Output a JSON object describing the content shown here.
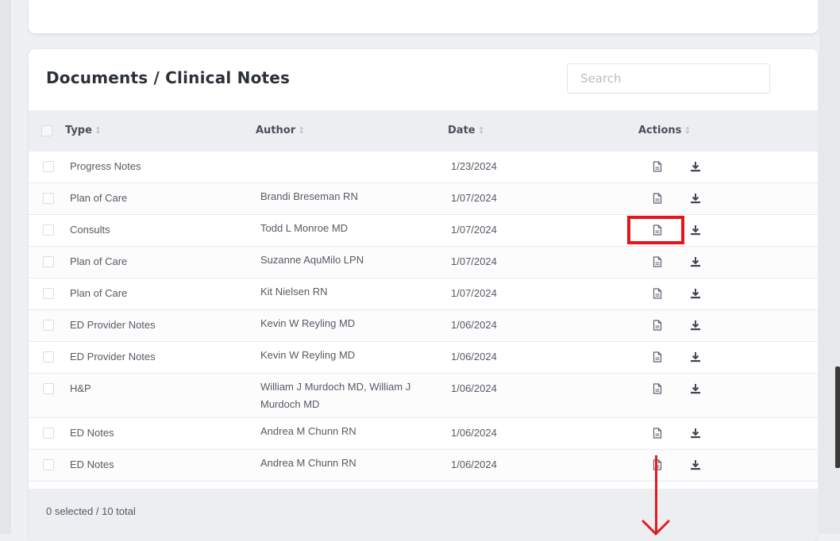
{
  "panel": {
    "title": "Documents / Clinical Notes",
    "search_placeholder": "Search"
  },
  "table": {
    "columns": {
      "type": "Type",
      "author": "Author",
      "date": "Date",
      "actions": "Actions",
      "sort_glyph": "↕"
    },
    "rows": [
      {
        "type": "Progress Notes",
        "author": "",
        "date": "1/23/2024"
      },
      {
        "type": "Plan of Care",
        "author": "Brandi Breseman RN",
        "date": "1/07/2024"
      },
      {
        "type": "Consults",
        "author": "Todd L Monroe MD",
        "date": "1/07/2024"
      },
      {
        "type": "Plan of Care",
        "author": "Suzanne AquMilo LPN",
        "date": "1/07/2024"
      },
      {
        "type": "Plan of Care",
        "author": "Kit Nielsen RN",
        "date": "1/07/2024"
      },
      {
        "type": "ED Provider Notes",
        "author": "Kevin W Reyling MD",
        "date": "1/06/2024"
      },
      {
        "type": "ED Provider Notes",
        "author": "Kevin W Reyling MD",
        "date": "1/06/2024"
      },
      {
        "type": "H&P",
        "author": "William J Murdoch MD, William J Murdoch MD",
        "date": "1/06/2024"
      },
      {
        "type": "ED Notes",
        "author": "Andrea M Chunn RN",
        "date": "1/06/2024"
      },
      {
        "type": "ED Notes",
        "author": "Andrea M Chunn RN",
        "date": "1/06/2024"
      }
    ]
  },
  "footer": {
    "summary": "0 selected / 10 total"
  },
  "icons": {
    "view": "document-icon",
    "download": "download-icon"
  },
  "annotation": {
    "color": "#e8141b",
    "highlighted_row": 3
  }
}
